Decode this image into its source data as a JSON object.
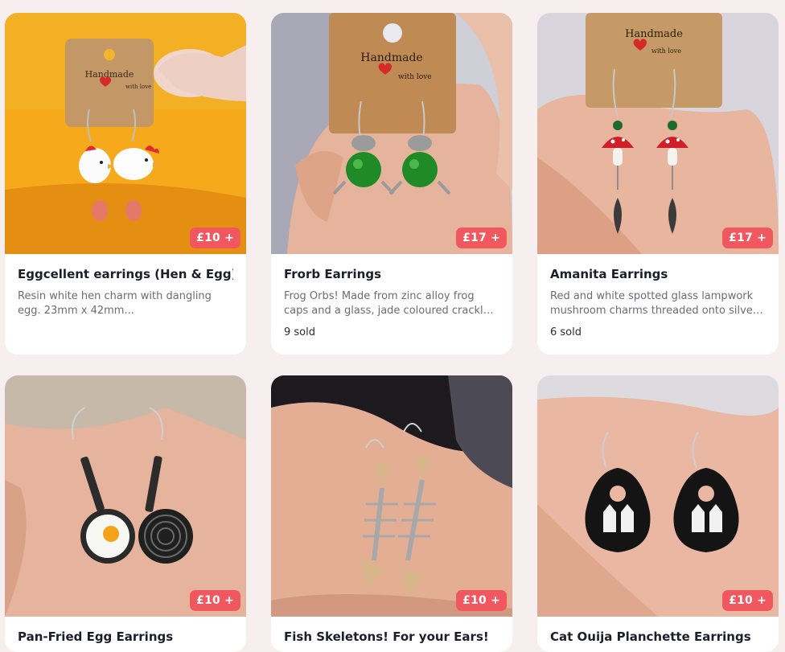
{
  "products": [
    {
      "title": " Eggcellent earrings (Hen & Egg)",
      "description": "Resin white hen charm with dangling egg. 23mm x 42mm...",
      "price": "£10 +",
      "sold": "",
      "image_desc": "hen-and-egg-earrings"
    },
    {
      "title": "Frorb Earrings",
      "description": "Frog Orbs! Made from zinc alloy frog caps and a glass, jade coloured crackle bead...",
      "price": "£17 +",
      "sold": "9 sold",
      "image_desc": "frog-orb-earrings"
    },
    {
      "title": "Amanita Earrings",
      "description": "Red and white spotted glass lampwork mushroom charms threaded onto silver wire...",
      "price": "£17 +",
      "sold": "6 sold",
      "image_desc": "mushroom-earrings"
    },
    {
      "title": "Pan-Fried Egg Earrings",
      "description": "",
      "price": "£10 +",
      "sold": "",
      "image_desc": "frying-pan-earrings"
    },
    {
      "title": "Fish Skeletons! For your Ears!",
      "description": "",
      "price": "£10 +",
      "sold": "",
      "image_desc": "fish-skeleton-earrings"
    },
    {
      "title": "Cat Ouija Planchette Earrings",
      "description": "",
      "price": "£10 +",
      "sold": "",
      "image_desc": "ouija-planchette-earrings"
    }
  ],
  "card_labels": {
    "handmade": "Handmade",
    "with_love": "with love"
  },
  "colors": {
    "price_badge": "#f0575f",
    "page_bg": "#f7eef0"
  }
}
